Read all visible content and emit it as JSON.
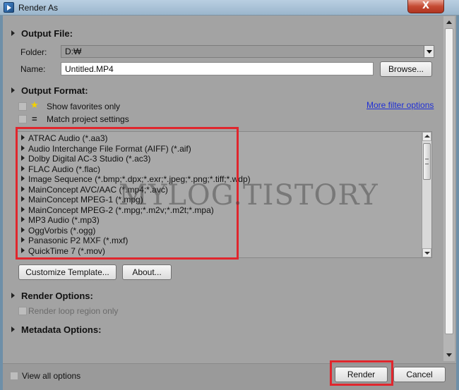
{
  "window": {
    "title": "Render As",
    "close_glyph": "X"
  },
  "output_file": {
    "header": "Output File:",
    "folder_label": "Folder:",
    "folder_value": "D:₩",
    "name_label": "Name:",
    "name_value": "Untitled.MP4",
    "browse_label": "Browse..."
  },
  "output_format": {
    "header": "Output Format:",
    "show_favorites_label": "Show favorites only",
    "match_project_label": "Match project settings",
    "more_filter_link": "More filter options",
    "formats": [
      "ATRAC Audio (*.aa3)",
      "Audio Interchange File Format (AIFF) (*.aif)",
      "Dolby Digital AC-3 Studio (*.ac3)",
      "FLAC Audio (*.flac)",
      "Image Sequence (*.bmp;*.dpx;*.exr;*.jpeg;*.png;*.tiff;*.wdp)",
      "MainConcept AVC/AAC (*.mp4;*.avc)",
      "MainConcept MPEG-1 (*.mpg)",
      "MainConcept MPEG-2 (*.mpg;*.m2v;*.m2t;*.mpa)",
      "MP3 Audio (*.mp3)",
      "OggVorbis (*.ogg)",
      "Panasonic P2 MXF (*.mxf)",
      "QuickTime 7 (*.mov)"
    ],
    "customize_template_label": "Customize Template...",
    "about_label": "About..."
  },
  "render_options": {
    "header": "Render Options:",
    "render_loop_label": "Render loop region only"
  },
  "metadata_options": {
    "header": "Metadata Options:"
  },
  "footer": {
    "view_all_label": "View all options",
    "render_label": "Render",
    "cancel_label": "Cancel"
  },
  "watermark": "MYLOG.TISTORY",
  "colors": {
    "highlight_border": "#e0262d",
    "link": "#1f2fd6",
    "dialog_background": "#a3a3a3"
  },
  "icons": {
    "favorites": "star-icon",
    "match_project": "equals-icon",
    "expand": "triangle-right-icon"
  }
}
